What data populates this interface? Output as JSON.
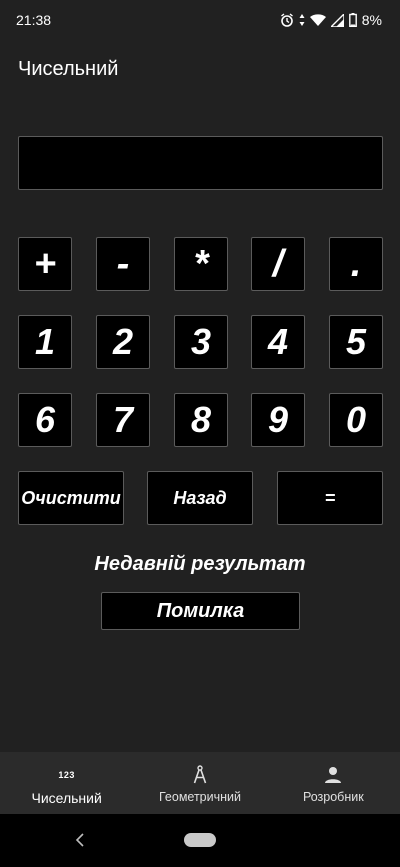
{
  "status_bar": {
    "time": "21:38",
    "battery": "8%"
  },
  "app": {
    "title": "Чисельний"
  },
  "calculator": {
    "display_value": "",
    "operators": [
      "+",
      "-",
      "*",
      "/",
      "."
    ],
    "digits_row1": [
      "1",
      "2",
      "3",
      "4",
      "5"
    ],
    "digits_row2": [
      "6",
      "7",
      "8",
      "9",
      "0"
    ],
    "clear_label": "Очистити",
    "back_label": "Назад",
    "equals_label": "="
  },
  "recent": {
    "label": "Недавній результат",
    "value": "Помилка"
  },
  "bottom_nav": {
    "items": [
      {
        "label": "Чисельний",
        "icon_text": "123",
        "icon": "numeric-123-icon"
      },
      {
        "label": "Геометричний",
        "icon": "compass-icon"
      },
      {
        "label": "Розробник",
        "icon": "person-icon"
      }
    ],
    "active_index": 0
  },
  "colors": {
    "background": "#212121",
    "key_bg": "#000000",
    "key_border": "#5b5b5b",
    "nav_bg": "#2b2b2b"
  }
}
